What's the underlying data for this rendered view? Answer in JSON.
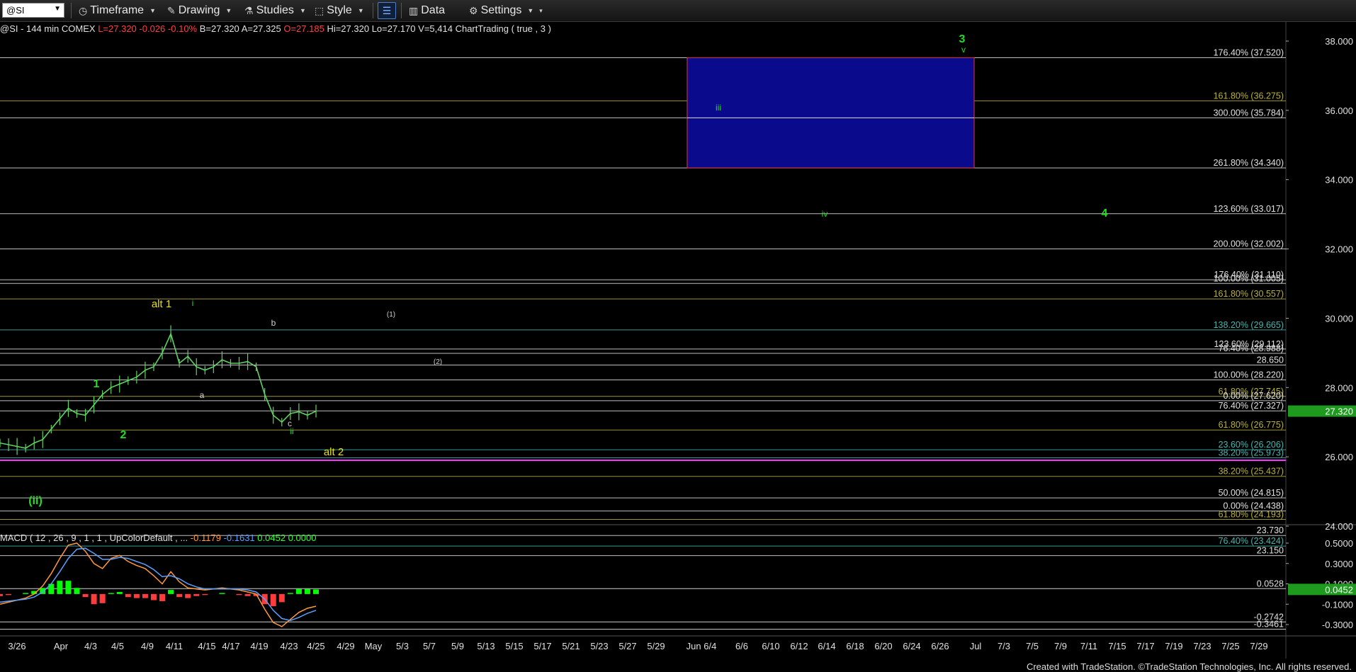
{
  "toolbar": {
    "symbol": "@SI",
    "timeframe_label": "Timeframe",
    "drawing_label": "Drawing",
    "studies_label": "Studies",
    "style_label": "Style",
    "data_label": "Data",
    "settings_label": "Settings"
  },
  "status_line": {
    "symbol_desc": "@SI - 144 min  COMEX",
    "last": "L=27.320",
    "change": "-0.026",
    "pct": "-0.10%",
    "bid": "B=27.320",
    "ask": "A=27.325",
    "open": "O=27.185",
    "high": "Hi=27.320",
    "low": "Lo=27.170",
    "volume": "V=5,414",
    "study": "ChartTrading ( true , 3 )"
  },
  "macd_line": {
    "label": "MACD ( 12 , 26 , 9 , 1 , 1 , UpColorDefault , ...",
    "v1": "-0.1179",
    "v2": "-0.1631",
    "v3": "0.0452",
    "v4": "0.0000"
  },
  "footer": "Created with TradeStation. ©TradeStation Technologies, Inc. All rights reserved.",
  "colors": {
    "up": "#00ff00",
    "down": "#ff3b3b",
    "price": "#5fd35f",
    "target_box": "#0a0a8c",
    "magenta": "#ff33ff",
    "green_wave": "#22dd22",
    "yellow_wave": "#e8e000"
  },
  "chart_data": {
    "type": "line",
    "title": "@SI - 144 min COMEX",
    "price_axis": {
      "ylim": [
        23.0,
        38.4
      ],
      "ticks": [
        24.0,
        26.0,
        28.0,
        30.0,
        32.0,
        34.0,
        36.0,
        38.0
      ],
      "tick_labels": [
        "24.000",
        "26.000",
        "28.000",
        "30.000",
        "32.000",
        "34.000",
        "36.000",
        "38.000"
      ],
      "current_price": 27.32,
      "current_price_label": "27.320"
    },
    "x_axis": {
      "tick_labels": [
        "3/26",
        "Apr",
        "4/3",
        "4/5",
        "4/9",
        "4/11",
        "4/15",
        "4/17",
        "4/19",
        "4/23",
        "4/25",
        "4/29",
        "May",
        "5/3",
        "5/7",
        "5/9",
        "5/13",
        "5/15",
        "5/17",
        "5/21",
        "5/23",
        "5/27",
        "5/29",
        "Jun 6/4",
        "6/6",
        "6/10",
        "6/12",
        "6/14",
        "6/18",
        "6/20",
        "6/24",
        "6/26",
        "Jul",
        "7/3",
        "7/5",
        "7/9",
        "7/11",
        "7/15",
        "7/17",
        "7/19",
        "7/23",
        "7/25",
        "7/29"
      ]
    },
    "price_series": [
      26.4,
      26.35,
      26.3,
      26.25,
      26.4,
      26.5,
      26.8,
      27.1,
      27.4,
      27.25,
      27.2,
      27.5,
      27.8,
      28.0,
      28.1,
      28.2,
      28.3,
      28.5,
      28.6,
      29.0,
      29.55,
      28.7,
      28.9,
      28.6,
      28.5,
      28.6,
      28.8,
      28.7,
      28.7,
      28.75,
      28.6,
      27.8,
      27.2,
      27.0,
      27.25,
      27.3,
      27.2,
      27.32
    ],
    "fib_levels": [
      {
        "label": "176.40% (37.520)",
        "value": 37.52,
        "color": "#e0e0e0"
      },
      {
        "label": "161.80% (36.275)",
        "value": 36.275,
        "color": "#b8b040"
      },
      {
        "label": "300.00% (35.784)",
        "value": 35.784,
        "color": "#e0e0e0"
      },
      {
        "label": "261.80% (34.340)",
        "value": 34.34,
        "color": "#e0e0e0"
      },
      {
        "label": "123.60% (33.017)",
        "value": 33.017,
        "color": "#e0e0e0"
      },
      {
        "label": "200.00% (32.002)",
        "value": 32.002,
        "color": "#e0e0e0"
      },
      {
        "label": "176.40% (31.110)",
        "value": 31.11,
        "color": "#e0e0e0"
      },
      {
        "label": "100.00% (31.005)",
        "value": 31.005,
        "color": "#e0e0e0"
      },
      {
        "label": "161.80% (30.557)",
        "value": 30.557,
        "color": "#b8b040"
      },
      {
        "label": "138.20% (29.665)",
        "value": 29.665,
        "color": "#48b4b0"
      },
      {
        "label": "123.60% (29.112)",
        "value": 29.112,
        "color": "#e0e0e0"
      },
      {
        "label": "76.40% (28.988)",
        "value": 28.988,
        "color": "#e0e0e0"
      },
      {
        "label": "28.650",
        "value": 28.65,
        "color": "#e0e0e0"
      },
      {
        "label": "100.00% (28.220)",
        "value": 28.22,
        "color": "#e0e0e0"
      },
      {
        "label": "61.80% (27.745)",
        "value": 27.745,
        "color": "#b8b040"
      },
      {
        "label": "0.00% (27.620)",
        "value": 27.62,
        "color": "#e0e0e0"
      },
      {
        "label": "76.40% (27.327)",
        "value": 27.327,
        "color": "#e0e0e0"
      },
      {
        "label": "61.80% (26.775)",
        "value": 26.775,
        "color": "#b8b040"
      },
      {
        "label": "23.60% (26.206)",
        "value": 26.206,
        "color": "#48b4b0"
      },
      {
        "label": "38.20% (25.973)",
        "value": 25.973,
        "color": "#48b4b0"
      },
      {
        "label": "38.20% (25.437)",
        "value": 25.437,
        "color": "#b8b040"
      },
      {
        "label": "50.00% (24.815)",
        "value": 24.815,
        "color": "#e0e0e0"
      },
      {
        "label": "0.00% (24.438)",
        "value": 24.438,
        "color": "#e0e0e0"
      },
      {
        "label": "61.80% (24.193)",
        "value": 24.193,
        "color": "#b8b040"
      },
      {
        "label": "23.730",
        "value": 23.73,
        "color": "#e0e0e0"
      },
      {
        "label": "76.40% (23.424)",
        "value": 23.424,
        "color": "#48b4b0"
      },
      {
        "label": "23.150",
        "value": 23.15,
        "color": "#e0e0e0"
      }
    ],
    "magenta_level": 25.9,
    "target_box": {
      "low": 34.34,
      "high": 37.52
    },
    "wave_labels": [
      {
        "text": "3",
        "color": "#22dd22",
        "bold": true
      },
      {
        "text": "v",
        "color": "#22dd22",
        "bold": false
      },
      {
        "text": "iii",
        "color": "#22dd22",
        "bold": false
      },
      {
        "text": "iv",
        "color": "#22dd22",
        "bold": false
      },
      {
        "text": "4",
        "color": "#22dd22",
        "bold": true
      },
      {
        "text": "alt 1",
        "color": "#e8e000",
        "bold": false
      },
      {
        "text": "i",
        "color": "#22dd22",
        "bold": false
      },
      {
        "text": "b",
        "color": "#d0d0d0",
        "bold": false
      },
      {
        "text": "(1)",
        "color": "#d0d0d0",
        "bold": false
      },
      {
        "text": "(2)",
        "color": "#d0d0d0",
        "bold": false
      },
      {
        "text": "1",
        "color": "#22dd22",
        "bold": true
      },
      {
        "text": "a",
        "color": "#d0d0d0",
        "bold": false
      },
      {
        "text": "c",
        "color": "#d0d0d0",
        "bold": false
      },
      {
        "text": "ii",
        "color": "#22dd22",
        "bold": false
      },
      {
        "text": "2",
        "color": "#22dd22",
        "bold": true
      },
      {
        "text": "alt 2",
        "color": "#e8e000",
        "bold": false
      },
      {
        "text": "(ii)",
        "color": "#22dd22",
        "bold": true
      }
    ],
    "macd": {
      "ylim": [
        -0.38,
        0.58
      ],
      "ticks": [
        0.5,
        0.3,
        0.1,
        -0.1,
        -0.3
      ],
      "tick_labels": [
        "0.5000",
        "0.3000",
        "0.1000",
        "-0.1000",
        "-0.3000"
      ],
      "level_labels": [
        {
          "label": "0.0528",
          "value": 0.0528
        },
        {
          "label": "-0.2742",
          "value": -0.2742
        },
        {
          "label": "-0.3461",
          "value": -0.3461
        }
      ],
      "current_label": "0.0452",
      "current_value": 0.0452,
      "macd": [
        -0.1,
        -0.08,
        -0.06,
        -0.04,
        0.0,
        0.08,
        0.2,
        0.35,
        0.48,
        0.5,
        0.42,
        0.3,
        0.25,
        0.35,
        0.38,
        0.32,
        0.28,
        0.25,
        0.18,
        0.1,
        0.22,
        0.12,
        0.06,
        0.05,
        0.04,
        0.05,
        0.06,
        0.05,
        0.04,
        0.02,
        0.0,
        -0.15,
        -0.28,
        -0.32,
        -0.25,
        -0.18,
        -0.14,
        -0.12
      ],
      "signal": [
        -0.08,
        -0.07,
        -0.06,
        -0.05,
        -0.03,
        0.02,
        0.1,
        0.22,
        0.35,
        0.44,
        0.45,
        0.4,
        0.34,
        0.34,
        0.36,
        0.35,
        0.32,
        0.29,
        0.24,
        0.17,
        0.18,
        0.15,
        0.1,
        0.07,
        0.05,
        0.05,
        0.05,
        0.05,
        0.05,
        0.04,
        0.02,
        -0.05,
        -0.16,
        -0.24,
        -0.26,
        -0.23,
        -0.19,
        -0.16
      ],
      "hist": [
        -0.02,
        -0.01,
        0.0,
        0.01,
        0.03,
        0.06,
        0.1,
        0.13,
        0.13,
        0.06,
        -0.03,
        -0.1,
        -0.09,
        0.01,
        0.02,
        -0.03,
        -0.04,
        -0.04,
        -0.06,
        -0.07,
        0.04,
        -0.03,
        -0.04,
        -0.02,
        -0.01,
        0.0,
        0.01,
        0.0,
        -0.01,
        -0.02,
        -0.02,
        -0.1,
        -0.12,
        -0.08,
        0.01,
        0.05,
        0.05,
        0.045
      ]
    }
  }
}
